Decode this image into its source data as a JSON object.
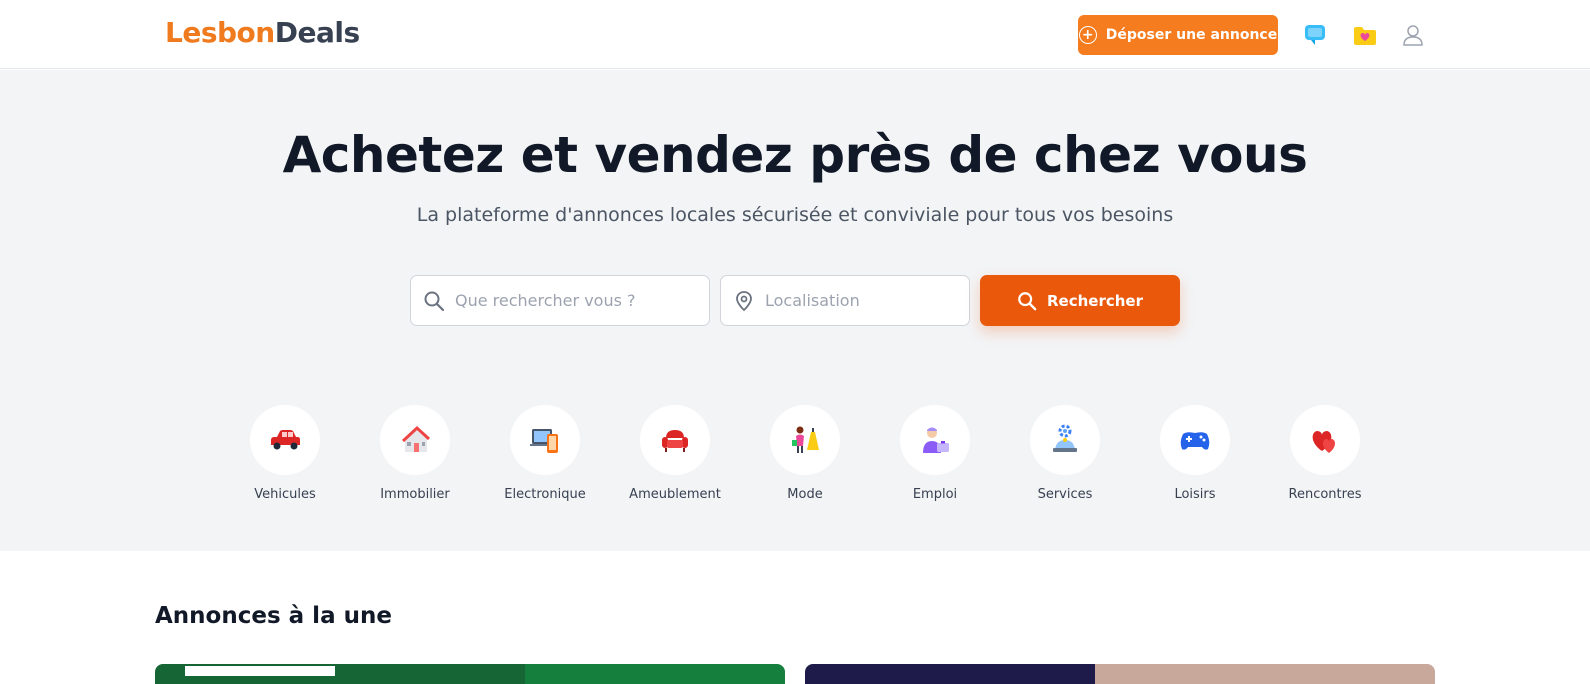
{
  "header": {
    "logo_part1": "Lesbon",
    "logo_part2": "Deals",
    "post_button": "Déposer une annonce",
    "icons": [
      "chat-icon",
      "favorites-folder-icon",
      "user-account-icon"
    ]
  },
  "hero": {
    "title": "Achetez et vendez près de chez vous",
    "subtitle": "La plateforme d'annonces locales sécurisée et conviviale pour tous vos besoins",
    "search_placeholder": "Que rechercher vous ?",
    "location_placeholder": "Localisation",
    "search_button": "Rechercher"
  },
  "categories": [
    {
      "label": "Vehicules",
      "icon": "car-icon"
    },
    {
      "label": "Immobilier",
      "icon": "house-icon"
    },
    {
      "label": "Electronique",
      "icon": "devices-icon"
    },
    {
      "label": "Ameublement",
      "icon": "armchair-icon"
    },
    {
      "label": "Mode",
      "icon": "fashion-icon"
    },
    {
      "label": "Emploi",
      "icon": "job-icon"
    },
    {
      "label": "Services",
      "icon": "services-icon"
    },
    {
      "label": "Loisirs",
      "icon": "gamepad-icon"
    },
    {
      "label": "Rencontres",
      "icon": "hearts-icon"
    }
  ],
  "featured": {
    "title": "Annonces à la une"
  },
  "colors": {
    "brand_orange": "#f57c1f",
    "search_orange": "#ea580c",
    "hero_bg": "#f3f4f6"
  }
}
